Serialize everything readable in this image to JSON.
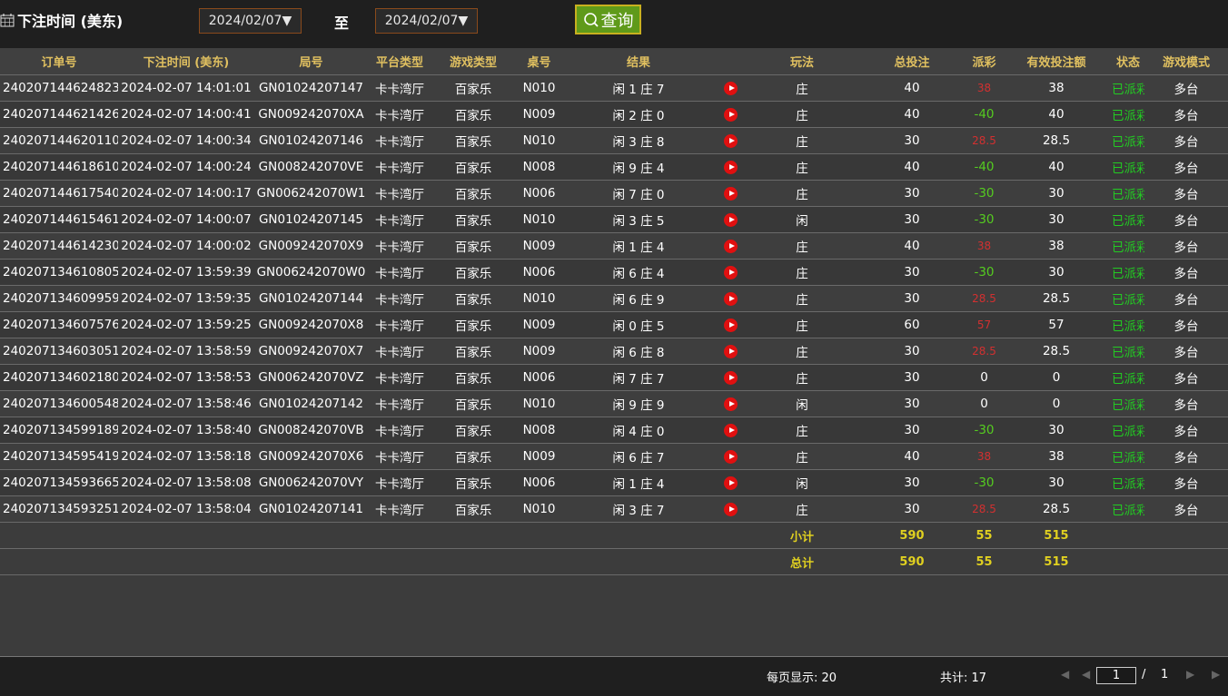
{
  "filter": {
    "title": "下注时间 (美东)",
    "date_from": "2024/02/07▼",
    "separator": "至",
    "date_to": "2024/02/07▼",
    "query_label": "查询"
  },
  "table": {
    "columns": [
      "订单号",
      "下注时间 (美东)",
      "局号",
      "平台类型",
      "游戏类型",
      "桌号",
      "结果",
      "",
      "玩法",
      "总投注",
      "派彩",
      "有效投注额",
      "状态",
      "游戏模式"
    ],
    "rows": [
      [
        "240207144624823",
        "2024-02-07 14:01:01",
        "GN01024207147",
        "卡卡湾厅",
        "百家乐",
        "N010",
        "闲 1 庄 7",
        "",
        "庄",
        "40",
        "38",
        "38",
        "已派彩",
        "多台"
      ],
      [
        "240207144621426",
        "2024-02-07 14:00:41",
        "GN009242070XA",
        "卡卡湾厅",
        "百家乐",
        "N009",
        "闲 2 庄 0",
        "",
        "庄",
        "40",
        "-40",
        "40",
        "已派彩",
        "多台"
      ],
      [
        "240207144620110",
        "2024-02-07 14:00:34",
        "GN01024207146",
        "卡卡湾厅",
        "百家乐",
        "N010",
        "闲 3 庄 8",
        "",
        "庄",
        "30",
        "28.5",
        "28.5",
        "已派彩",
        "多台"
      ],
      [
        "240207144618610",
        "2024-02-07 14:00:24",
        "GN008242070VE",
        "卡卡湾厅",
        "百家乐",
        "N008",
        "闲 9 庄 4",
        "",
        "庄",
        "40",
        "-40",
        "40",
        "已派彩",
        "多台"
      ],
      [
        "240207144617540",
        "2024-02-07 14:00:17",
        "GN006242070W1",
        "卡卡湾厅",
        "百家乐",
        "N006",
        "闲 7 庄 0",
        "",
        "庄",
        "30",
        "-30",
        "30",
        "已派彩",
        "多台"
      ],
      [
        "240207144615461",
        "2024-02-07 14:00:07",
        "GN01024207145",
        "卡卡湾厅",
        "百家乐",
        "N010",
        "闲 3 庄 5",
        "",
        "闲",
        "30",
        "-30",
        "30",
        "已派彩",
        "多台"
      ],
      [
        "240207144614230",
        "2024-02-07 14:00:02",
        "GN009242070X9",
        "卡卡湾厅",
        "百家乐",
        "N009",
        "闲 1 庄 4",
        "",
        "庄",
        "40",
        "38",
        "38",
        "已派彩",
        "多台"
      ],
      [
        "240207134610805",
        "2024-02-07 13:59:39",
        "GN006242070W0",
        "卡卡湾厅",
        "百家乐",
        "N006",
        "闲 6 庄 4",
        "",
        "庄",
        "30",
        "-30",
        "30",
        "已派彩",
        "多台"
      ],
      [
        "240207134609959",
        "2024-02-07 13:59:35",
        "GN01024207144",
        "卡卡湾厅",
        "百家乐",
        "N010",
        "闲 6 庄 9",
        "",
        "庄",
        "30",
        "28.5",
        "28.5",
        "已派彩",
        "多台"
      ],
      [
        "240207134607576",
        "2024-02-07 13:59:25",
        "GN009242070X8",
        "卡卡湾厅",
        "百家乐",
        "N009",
        "闲 0 庄 5",
        "",
        "庄",
        "60",
        "57",
        "57",
        "已派彩",
        "多台"
      ],
      [
        "240207134603051",
        "2024-02-07 13:58:59",
        "GN009242070X7",
        "卡卡湾厅",
        "百家乐",
        "N009",
        "闲 6 庄 8",
        "",
        "庄",
        "30",
        "28.5",
        "28.5",
        "已派彩",
        "多台"
      ],
      [
        "240207134602180",
        "2024-02-07 13:58:53",
        "GN006242070VZ",
        "卡卡湾厅",
        "百家乐",
        "N006",
        "闲 7 庄 7",
        "",
        "庄",
        "30",
        "0",
        "0",
        "已派彩",
        "多台"
      ],
      [
        "240207134600548",
        "2024-02-07 13:58:46",
        "GN01024207142",
        "卡卡湾厅",
        "百家乐",
        "N010",
        "闲 9 庄 9",
        "",
        "闲",
        "30",
        "0",
        "0",
        "已派彩",
        "多台"
      ],
      [
        "240207134599189",
        "2024-02-07 13:58:40",
        "GN008242070VB",
        "卡卡湾厅",
        "百家乐",
        "N008",
        "闲 4 庄 0",
        "",
        "庄",
        "30",
        "-30",
        "30",
        "已派彩",
        "多台"
      ],
      [
        "240207134595419",
        "2024-02-07 13:58:18",
        "GN009242070X6",
        "卡卡湾厅",
        "百家乐",
        "N009",
        "闲 6 庄 7",
        "",
        "庄",
        "40",
        "38",
        "38",
        "已派彩",
        "多台"
      ],
      [
        "240207134593665",
        "2024-02-07 13:58:08",
        "GN006242070VY",
        "卡卡湾厅",
        "百家乐",
        "N006",
        "闲 1 庄 4",
        "",
        "闲",
        "30",
        "-30",
        "30",
        "已派彩",
        "多台"
      ],
      [
        "240207134593251",
        "2024-02-07 13:58:04",
        "GN01024207141",
        "卡卡湾厅",
        "百家乐",
        "N010",
        "闲 3 庄 7",
        "",
        "庄",
        "30",
        "28.5",
        "28.5",
        "已派彩",
        "多台"
      ]
    ],
    "subtotal": {
      "label": "小计",
      "total_bet": "590",
      "payout": "55",
      "valid_bet": "515"
    },
    "grandtotal": {
      "label": "总计",
      "total_bet": "590",
      "payout": "55",
      "valid_bet": "515"
    }
  },
  "footer": {
    "per_page": "每页显示: 20",
    "total": "共计: 17",
    "page_input": "1",
    "slash": "/",
    "total_pages": "1"
  },
  "colors": {
    "header_text": "#e0c060",
    "positive_payout": "#d23030",
    "negative_payout": "#55cc20",
    "status": "#22cc22",
    "summary": "#e0d020",
    "query_button": "#5f9a1a"
  },
  "icons": {
    "calendar": "calendar-icon",
    "search": "search-icon",
    "video": "play-video-icon",
    "pager": [
      "first-page-icon",
      "prev-page-icon",
      "next-page-icon",
      "last-page-icon"
    ]
  }
}
